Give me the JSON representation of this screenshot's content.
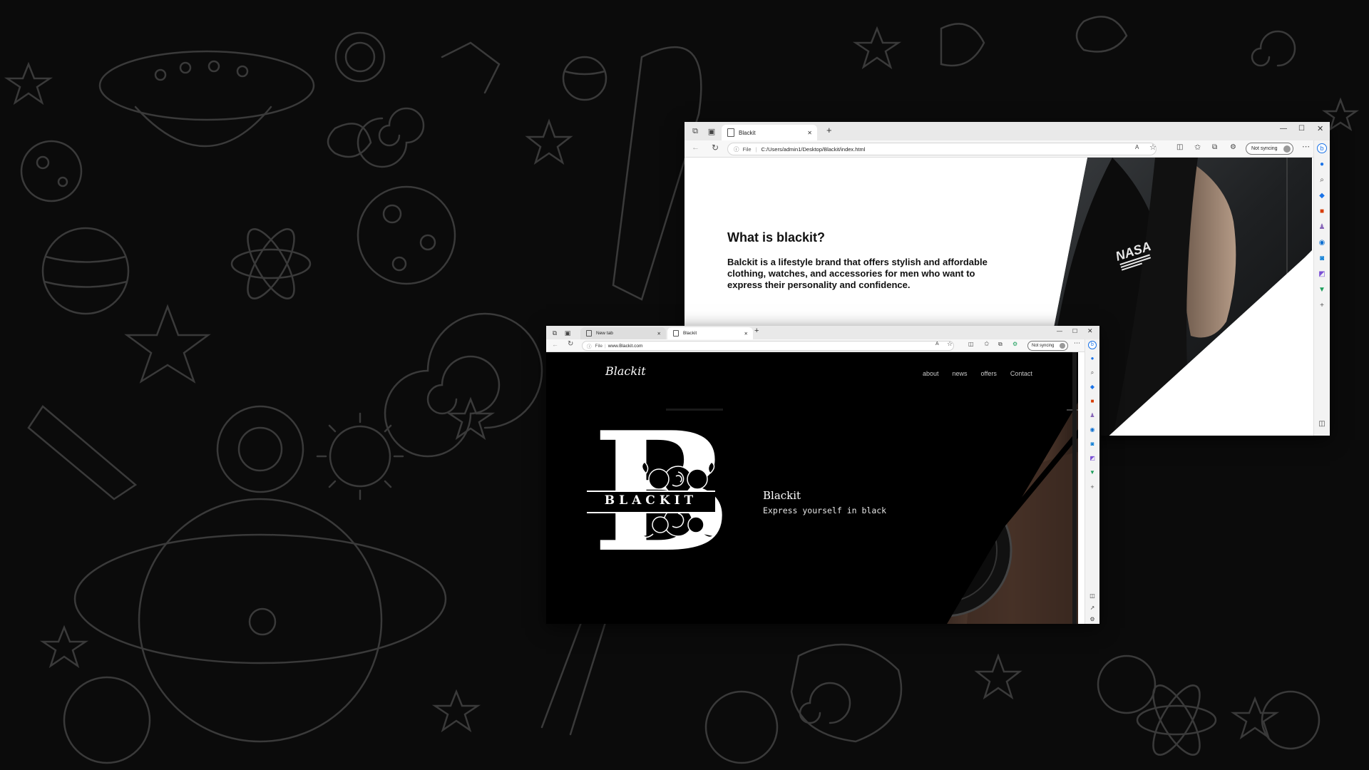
{
  "windowA": {
    "tabs": [
      {
        "label": "Blackit"
      }
    ],
    "address": {
      "protocol": "File",
      "url": "C:/Users/admin1/Desktop/Blackit/index.html"
    },
    "sync_label": "Not syncing",
    "content": {
      "heading": "What is blackit?",
      "body": "Balckit is a lifestyle brand that offers stylish and affordable clothing, watches, and accessories for men who want to express their personality and confidence.",
      "shirt_logo": "NASA"
    }
  },
  "windowB": {
    "tabs": [
      {
        "label": "New tab"
      },
      {
        "label": "Blackit"
      }
    ],
    "address": {
      "protocol": "File",
      "url": "www.Blackit.com"
    },
    "sync_label": "Not syncing",
    "site": {
      "logo_text": "Blackit",
      "nav": [
        "about",
        "news",
        "offers",
        "Contact"
      ],
      "monogram_letter": "B",
      "monogram_word": "BLACKIT",
      "hero_title": "Blackit",
      "hero_subtitle": "Express yourself in black"
    }
  },
  "icons": {
    "sidebar": [
      "bing-chat-icon",
      "bell-icon",
      "search-icon",
      "tag-icon",
      "briefcase-icon",
      "games-icon",
      "office-icon",
      "outlook-icon",
      "designer-icon",
      "drop-icon",
      "add-icon"
    ]
  },
  "colors": {
    "page_bg": "#0b0b0b",
    "doodle": "#3a3a3a",
    "site_bg": "#000000",
    "accent_blue": "#1a73e8"
  }
}
